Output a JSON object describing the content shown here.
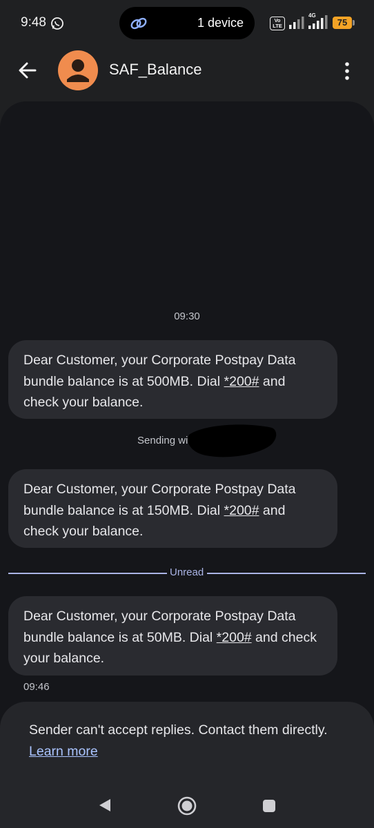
{
  "status_bar": {
    "time": "9:48",
    "pill_text": "1 device",
    "volte": "Vo\nLTE",
    "network_tag": "4G",
    "battery": "75",
    "battery_color": "#f4a326"
  },
  "header": {
    "contact_name": "SAF_Balance",
    "avatar_color": "#f08c4e"
  },
  "messages": [
    {
      "time_above": "09:30",
      "pre": "Dear Customer, your Corporate Postpay Data bundle balance is at 500MB. Dial ",
      "code": "*200#",
      "post": " and check your balance."
    },
    {
      "status_label": "Sending wi",
      "pre": "Dear Customer, your Corporate Postpay Data bundle balance is at 150MB. Dial ",
      "code": "*200#",
      "post": " and check your balance."
    },
    {
      "divider_label": "Unread",
      "pre": "Dear Customer, your Corporate Postpay Data bundle balance is at 50MB. Dial ",
      "code": "*200#",
      "post": " and check your balance.",
      "time_below": "09:46"
    }
  ],
  "notice": {
    "text": "Sender can't accept replies. Contact them directly.",
    "link": "Learn more"
  },
  "colors": {
    "background": "#15161a",
    "bubble": "#2a2b30",
    "accent_link": "#aac4ff",
    "divider": "#aab4e6"
  },
  "icons": [
    "whatsapp-icon",
    "link-icon",
    "signal-icon",
    "back-arrow-icon",
    "person-icon",
    "more-vert-icon",
    "nav-back-icon",
    "nav-home-icon",
    "nav-recents-icon"
  ]
}
